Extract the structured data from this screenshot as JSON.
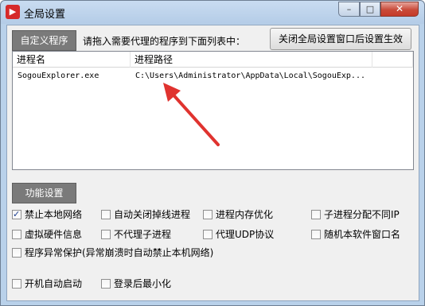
{
  "window": {
    "title": "全局设置",
    "app_icon": "app-logo-icon",
    "controls": {
      "minimize": "–",
      "maximize": "□",
      "close": "✕"
    }
  },
  "toolbar": {
    "custom_programs_label": "自定义程序",
    "hint": "请拖入需要代理的程序到下面列表中：",
    "close_effect_label": "关闭全局设置窗口后设置生效"
  },
  "table": {
    "columns": [
      "进程名",
      "进程路径",
      ""
    ],
    "rows": [
      {
        "name": "SogouExplorer.exe",
        "path": "C:\\Users\\Administrator\\AppData\\Local\\SogouExp..."
      }
    ]
  },
  "functions": {
    "title": "功能设置",
    "options": [
      {
        "label": "禁止本地网络",
        "checked": true
      },
      {
        "label": "自动关闭掉线进程",
        "checked": false
      },
      {
        "label": "进程内存优化",
        "checked": false
      },
      {
        "label": "子进程分配不同IP",
        "checked": false
      },
      {
        "label": "虚拟硬件信息",
        "checked": false
      },
      {
        "label": "不代理子进程",
        "checked": false
      },
      {
        "label": "代理UDP协议",
        "checked": false
      },
      {
        "label": "随机本软件窗口名",
        "checked": false
      },
      {
        "label": "程序异常保护(异常崩溃时自动禁止本机网络)",
        "checked": false
      },
      {
        "label": "开机自动启动",
        "checked": false
      },
      {
        "label": "登录后最小化",
        "checked": false
      }
    ]
  },
  "colors": {
    "annotation_arrow": "#e0332f",
    "title_bar": "#b9d1ea"
  }
}
